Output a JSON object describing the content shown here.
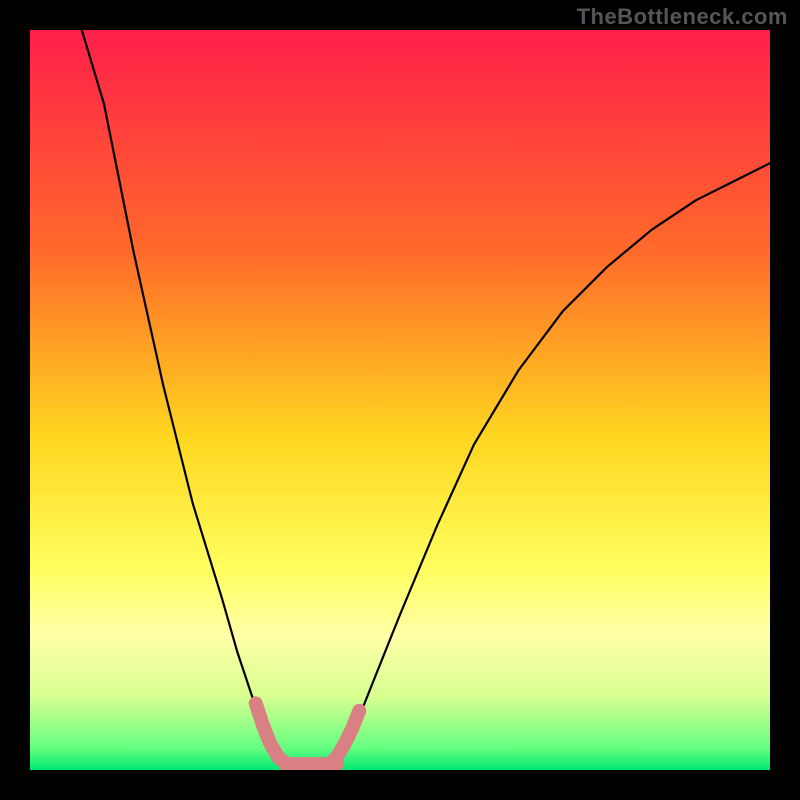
{
  "watermark": "TheBottleneck.com",
  "chart_data": {
    "type": "line",
    "title": "",
    "xlabel": "",
    "ylabel": "",
    "xlim": [
      0,
      100
    ],
    "ylim": [
      0,
      100
    ],
    "grid": false,
    "legend": false,
    "background_gradient": {
      "stops": [
        {
          "offset": 0.0,
          "color": "#ff1f4a"
        },
        {
          "offset": 0.3,
          "color": "#ff6a2a"
        },
        {
          "offset": 0.55,
          "color": "#ffd61f"
        },
        {
          "offset": 0.73,
          "color": "#ffff60"
        },
        {
          "offset": 0.82,
          "color": "#ffffa8"
        },
        {
          "offset": 0.9,
          "color": "#d8ff90"
        },
        {
          "offset": 0.97,
          "color": "#66ff80"
        },
        {
          "offset": 1.0,
          "color": "#00e870"
        }
      ]
    },
    "series": [
      {
        "name": "left-curve",
        "style": "black-thin",
        "points": [
          {
            "x": 7,
            "y": 100
          },
          {
            "x": 10,
            "y": 90
          },
          {
            "x": 14,
            "y": 70
          },
          {
            "x": 18,
            "y": 52
          },
          {
            "x": 22,
            "y": 36
          },
          {
            "x": 26,
            "y": 23
          },
          {
            "x": 28,
            "y": 16
          },
          {
            "x": 30,
            "y": 10
          },
          {
            "x": 31.5,
            "y": 6
          },
          {
            "x": 33,
            "y": 3
          },
          {
            "x": 34,
            "y": 1.5
          },
          {
            "x": 35,
            "y": 0.8
          },
          {
            "x": 36,
            "y": 0.6
          }
        ]
      },
      {
        "name": "right-curve",
        "style": "black-thin",
        "points": [
          {
            "x": 40,
            "y": 0.6
          },
          {
            "x": 41,
            "y": 0.8
          },
          {
            "x": 42,
            "y": 2
          },
          {
            "x": 44,
            "y": 6
          },
          {
            "x": 46,
            "y": 11
          },
          {
            "x": 50,
            "y": 21
          },
          {
            "x": 55,
            "y": 33
          },
          {
            "x": 60,
            "y": 44
          },
          {
            "x": 66,
            "y": 54
          },
          {
            "x": 72,
            "y": 62
          },
          {
            "x": 78,
            "y": 68
          },
          {
            "x": 84,
            "y": 73
          },
          {
            "x": 90,
            "y": 77
          },
          {
            "x": 96,
            "y": 80
          },
          {
            "x": 100,
            "y": 82
          }
        ]
      },
      {
        "name": "floor",
        "style": "black-thin",
        "points": [
          {
            "x": 36,
            "y": 0.6
          },
          {
            "x": 40,
            "y": 0.6
          }
        ]
      },
      {
        "name": "highlight-left",
        "style": "pink-thick",
        "points": [
          {
            "x": 30.5,
            "y": 9
          },
          {
            "x": 31.5,
            "y": 6
          },
          {
            "x": 32.5,
            "y": 3.5
          },
          {
            "x": 33.5,
            "y": 1.8
          },
          {
            "x": 34.5,
            "y": 0.9
          },
          {
            "x": 36,
            "y": 0.6
          }
        ]
      },
      {
        "name": "highlight-floor",
        "style": "pink-thick",
        "points": [
          {
            "x": 34.5,
            "y": 0.8
          },
          {
            "x": 41.5,
            "y": 0.8
          }
        ]
      },
      {
        "name": "highlight-right",
        "style": "pink-thick",
        "points": [
          {
            "x": 40.5,
            "y": 0.8
          },
          {
            "x": 41.5,
            "y": 1.8
          },
          {
            "x": 42.5,
            "y": 3.5
          },
          {
            "x": 43.5,
            "y": 5.5
          },
          {
            "x": 44.5,
            "y": 8
          }
        ]
      }
    ]
  }
}
